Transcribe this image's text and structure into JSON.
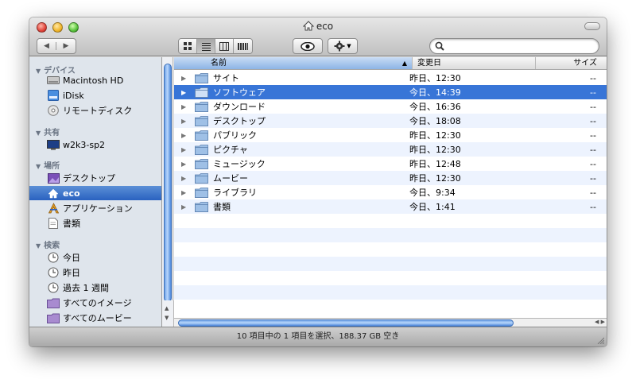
{
  "window": {
    "title": "eco"
  },
  "toolbar": {
    "nav_back": "◀",
    "nav_forward": "▶",
    "views": [
      "icon-view",
      "list-view",
      "column-view",
      "coverflow-view"
    ],
    "active_view": "list-view",
    "search_placeholder": ""
  },
  "sidebar": {
    "sections": [
      {
        "label": "デバイス",
        "items": [
          {
            "label": "Macintosh HD",
            "icon": "hard-disk-icon"
          },
          {
            "label": "iDisk",
            "icon": "idisk-icon"
          },
          {
            "label": "リモートディスク",
            "icon": "remote-disc-icon"
          }
        ]
      },
      {
        "label": "共有",
        "items": [
          {
            "label": "w2k3-sp2",
            "icon": "shared-computer-icon"
          }
        ]
      },
      {
        "label": "場所",
        "items": [
          {
            "label": "デスクトップ",
            "icon": "desktop-icon"
          },
          {
            "label": "eco",
            "icon": "home-icon",
            "selected": true
          },
          {
            "label": "アプリケーション",
            "icon": "applications-icon"
          },
          {
            "label": "書類",
            "icon": "documents-icon"
          }
        ]
      },
      {
        "label": "検索",
        "items": [
          {
            "label": "今日",
            "icon": "clock-icon"
          },
          {
            "label": "昨日",
            "icon": "clock-icon"
          },
          {
            "label": "過去 1 週間",
            "icon": "clock-icon"
          },
          {
            "label": "すべてのイメージ",
            "icon": "smart-folder-icon"
          },
          {
            "label": "すべてのムービー",
            "icon": "smart-folder-icon"
          }
        ]
      }
    ]
  },
  "list": {
    "columns": {
      "name": "名前",
      "date": "変更日",
      "size": "サイズ"
    },
    "rows": [
      {
        "name": "サイト",
        "date": "昨日、12:30",
        "size": "--"
      },
      {
        "name": "ソフトウェア",
        "date": "今日、14:39",
        "size": "--",
        "selected": true
      },
      {
        "name": "ダウンロード",
        "date": "今日、16:36",
        "size": "--"
      },
      {
        "name": "デスクトップ",
        "date": "今日、18:08",
        "size": "--"
      },
      {
        "name": "パブリック",
        "date": "昨日、12:30",
        "size": "--"
      },
      {
        "name": "ピクチャ",
        "date": "昨日、12:30",
        "size": "--"
      },
      {
        "name": "ミュージック",
        "date": "昨日、12:48",
        "size": "--"
      },
      {
        "name": "ムービー",
        "date": "昨日、12:30",
        "size": "--"
      },
      {
        "name": "ライブラリ",
        "date": "今日、9:34",
        "size": "--"
      },
      {
        "name": "書類",
        "date": "今日、1:41",
        "size": "--"
      }
    ]
  },
  "status": {
    "text": "10 項目中の 1 項目を選択、188.37 GB 空き"
  },
  "colors": {
    "selection": "#3875d7",
    "sidebar_bg": "#dfe5ec",
    "alt_row": "#edf3fe"
  }
}
